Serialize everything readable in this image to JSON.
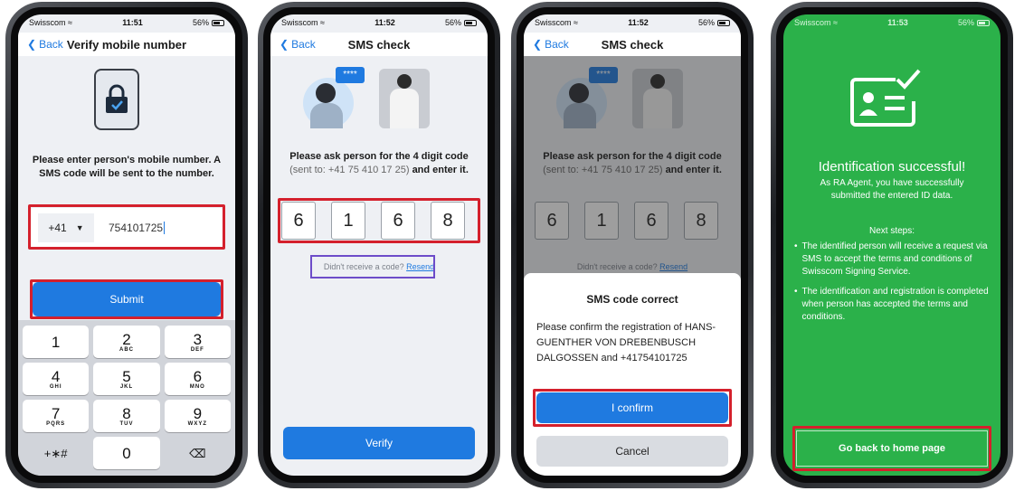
{
  "status": {
    "carrier": "Swisscom",
    "battery": "56%"
  },
  "screens": [
    {
      "time": "11:51",
      "back": "Back",
      "title": "Verify mobile number",
      "prompt": "Please enter person's mobile number. A SMS code will be sent to the number.",
      "country_code": "+41",
      "phone_value": "754101725",
      "submit": "Submit",
      "keypad": [
        {
          "d": "1",
          "l": ""
        },
        {
          "d": "2",
          "l": "ABC"
        },
        {
          "d": "3",
          "l": "DEF"
        },
        {
          "d": "4",
          "l": "GHI"
        },
        {
          "d": "5",
          "l": "JKL"
        },
        {
          "d": "6",
          "l": "MNO"
        },
        {
          "d": "7",
          "l": "PQRS"
        },
        {
          "d": "8",
          "l": "TUV"
        },
        {
          "d": "9",
          "l": "WXYZ"
        },
        {
          "d": "+∗#",
          "l": ""
        },
        {
          "d": "0",
          "l": ""
        },
        {
          "d": "⌫",
          "l": ""
        }
      ]
    },
    {
      "time": "11:52",
      "back": "Back",
      "title": "SMS check",
      "prompt": "Please ask person for the 4 digit code",
      "sent_to": "(sent to: +41 75 410 17 25)",
      "enter": "and enter it.",
      "digits": [
        "6",
        "1",
        "6",
        "8"
      ],
      "no_code": "Didn't receive a code?",
      "resend": "Resend",
      "verify": "Verify",
      "bubble": "****"
    },
    {
      "time": "11:52",
      "back": "Back",
      "title": "SMS check",
      "prompt": "Please ask person for the 4 digit code",
      "sent_to": "(sent to: +41 75 410 17 25)",
      "enter": "and enter it.",
      "digits": [
        "6",
        "1",
        "6",
        "8"
      ],
      "no_code": "Didn't receive a code?",
      "resend": "Resend",
      "sheet_title": "SMS code correct",
      "sheet_body": "Please confirm the registration of HANS-GUENTHER VON DREBENBUSCH DALGOSSEN and +41754101725",
      "confirm": "I confirm",
      "cancel": "Cancel",
      "bubble": "****"
    },
    {
      "time": "11:53",
      "title": "Identification successful!",
      "subtitle": "As RA Agent, you have successfully submitted the entered ID data.",
      "next": "Next steps:",
      "bullets": [
        "The identified person will receive a request via SMS to accept the terms and conditions of Swisscom Signing Service.",
        "The identification and registration is completed when person has accepted the terms and conditions."
      ],
      "home": "Go back to home page"
    }
  ],
  "colors": {
    "blue": "#1f7ae0",
    "red": "#d4202c",
    "purple": "#6d4cc9",
    "green": "#2bb14a"
  },
  "icons": [
    "wifi-icon",
    "lock-icon",
    "chevron-left-icon",
    "id-card-check-icon"
  ]
}
